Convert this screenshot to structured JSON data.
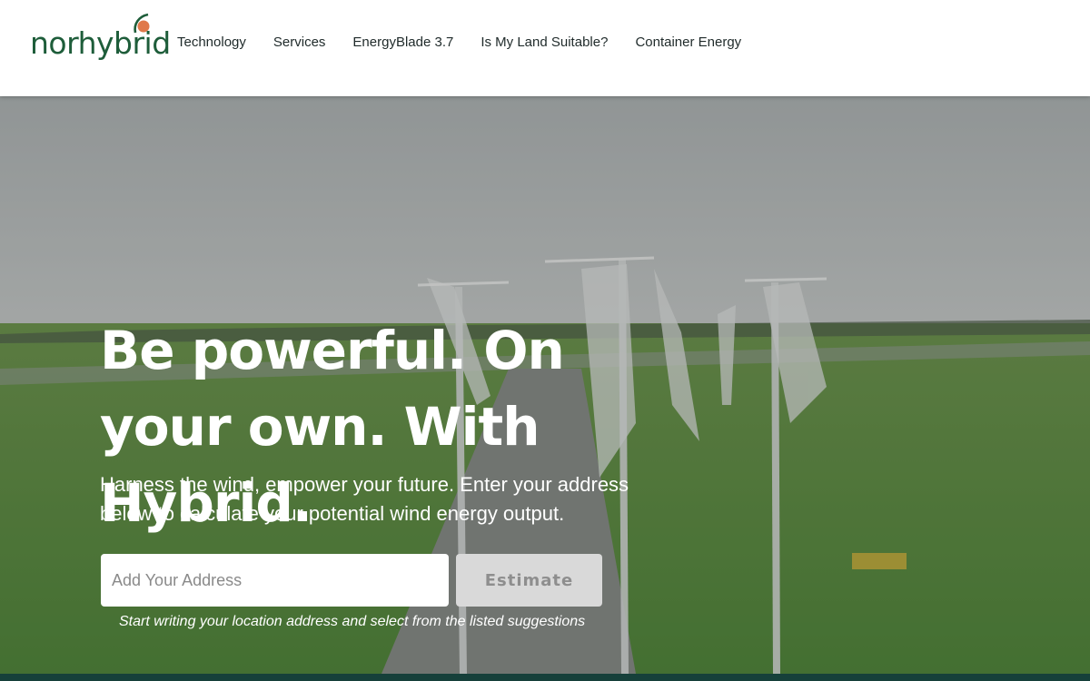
{
  "brand": {
    "name": "norhybrid",
    "color": "#1e5d3a",
    "accent": "#e0784a"
  },
  "nav": {
    "items": [
      {
        "label": "Technology"
      },
      {
        "label": "Services"
      },
      {
        "label": "EnergyBlade 3.7"
      },
      {
        "label": "Is My Land Suitable?"
      },
      {
        "label": "Container Energy"
      }
    ]
  },
  "hero": {
    "headline": "Be powerful. On your own. With Hybrid.",
    "subtext": "Harness the wind, empower your future. Enter your address below to calculate your potential wind energy output.",
    "address_placeholder": "Add Your Address",
    "estimate_label": "Estimate",
    "hint": "Start writing your location address and select from the listed suggestions"
  },
  "colors": {
    "footer_strip": "#16403a",
    "button_bg": "#d9d9d9"
  }
}
